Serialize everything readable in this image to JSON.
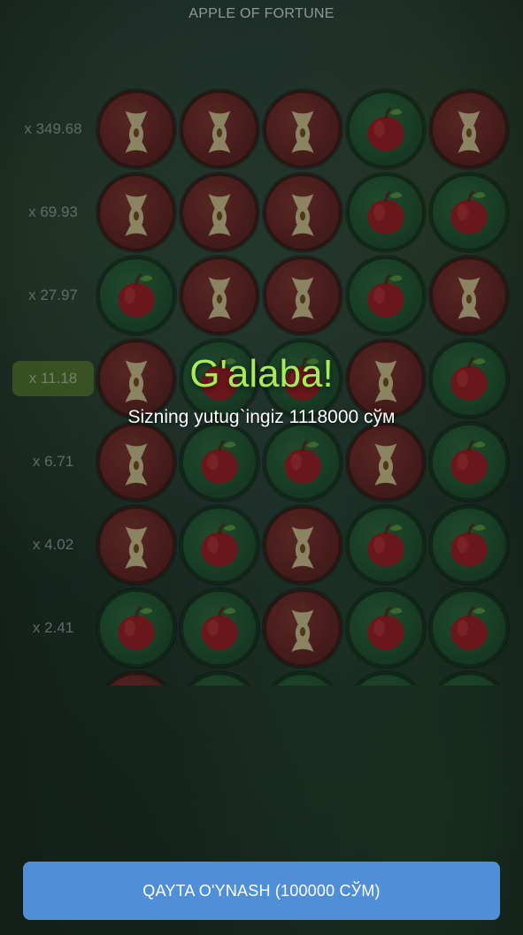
{
  "header": {
    "title": "APPLE OF FORTUNE"
  },
  "multipliers": [
    "x 349.68",
    "x 69.93",
    "x 27.97",
    "x 11.18",
    "x 6.71",
    "x 4.02",
    "x 2.41"
  ],
  "active_multiplier_index": 3,
  "grid": [
    [
      "core",
      "core",
      "core",
      "apple",
      "core"
    ],
    [
      "core",
      "core",
      "core",
      "apple",
      "apple"
    ],
    [
      "apple",
      "core",
      "core",
      "apple",
      "core"
    ],
    [
      "core",
      "apple",
      "apple",
      "core",
      "apple"
    ],
    [
      "core",
      "apple",
      "apple",
      "core",
      "apple"
    ],
    [
      "core",
      "apple",
      "core",
      "apple",
      "apple"
    ],
    [
      "apple",
      "apple",
      "core",
      "apple",
      "apple"
    ],
    [
      "core",
      "apple",
      "apple",
      "apple",
      "apple"
    ]
  ],
  "icons": {
    "apple": "red-apple-icon",
    "core": "apple-core-icon"
  },
  "result": {
    "title": "G'alaba!",
    "message": "Sizning yutug`ingiz 1118000 сўм"
  },
  "play_again_button": {
    "label": "QAYTA O'YNASH (100000 СЎМ)"
  },
  "colors": {
    "win_text": "#a9ea5b",
    "button": "#4f8fd8",
    "active_multiplier": "#7aaa28"
  }
}
